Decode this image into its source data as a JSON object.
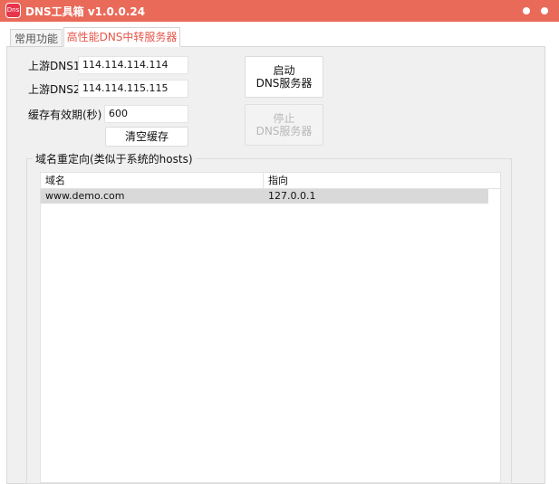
{
  "window": {
    "logo_text": "Dns",
    "title": "DNS工具箱 v1.0.0.24"
  },
  "tabs": [
    {
      "label": "常用功能",
      "active": false
    },
    {
      "label": "高性能DNS中转服务器",
      "active": true
    }
  ],
  "dns_form": {
    "dns1_label": "上游DNS1:",
    "dns1_value": "114.114.114.114",
    "dns2_label": "上游DNS2:",
    "dns2_value": "114.114.115.115",
    "cache_label": "缓存有效期(秒)",
    "cache_value": "600",
    "clear_cache_label": "清空缓存",
    "start_label_1": "启动",
    "start_label_2": "DNS服务器",
    "stop_label_1": "停止",
    "stop_label_2": "DNS服务器"
  },
  "redirect": {
    "group_title": "域名重定向(类似于系统的hosts)",
    "columns": [
      "域名",
      "指向"
    ],
    "rows": [
      {
        "domain": "www.demo.com",
        "target": "127.0.0.1"
      }
    ]
  },
  "colors": {
    "titlebar": "#ea6a5a",
    "active_tab_text": "#e6564a",
    "selected_row": "#d9d9d9"
  }
}
